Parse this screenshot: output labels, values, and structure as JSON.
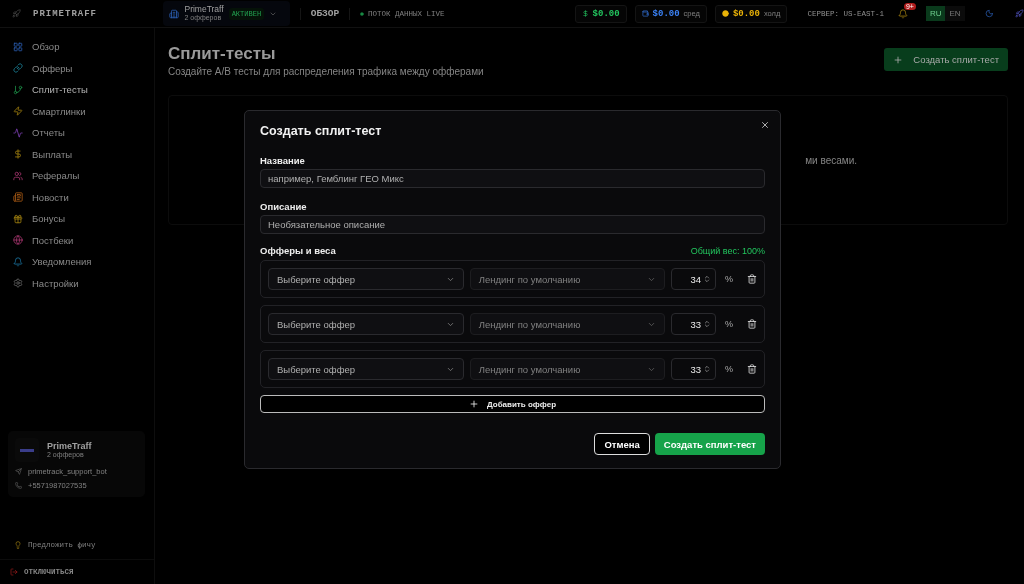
{
  "brand": {
    "name": "PRIMETRAFF"
  },
  "topbar": {
    "workspace": {
      "name": "PrimeTraff",
      "sub": "2 офферов",
      "badge": "АКТИВЕН"
    },
    "page": "ОБЗОР",
    "live": "ПОТОК ДАННЫХ LIVE",
    "balances": [
      {
        "amount": "$0.00",
        "color": "#22c55e"
      },
      {
        "amount": "$0.00",
        "label": "сред",
        "color": "#3b82f6"
      },
      {
        "amount": "$0.00",
        "label": "холд",
        "color": "#eab308"
      }
    ],
    "server": "СЕРВЕР: US-EAST-1",
    "notifications": "9+",
    "languages": [
      {
        "label": "RU",
        "selected": true
      },
      {
        "label": "EN",
        "selected": false
      }
    ]
  },
  "sidebar": {
    "items": [
      {
        "label": "Обзор",
        "selected": false
      },
      {
        "label": "Офферы",
        "selected": false
      },
      {
        "label": "Сплит-тесты",
        "selected": true
      },
      {
        "label": "Смартлинки",
        "selected": false
      },
      {
        "label": "Отчеты",
        "selected": false
      },
      {
        "label": "Выплаты",
        "selected": false
      },
      {
        "label": "Рефералы",
        "selected": false
      },
      {
        "label": "Новости",
        "selected": false
      },
      {
        "label": "Бонусы",
        "selected": false
      },
      {
        "label": "Постбеки",
        "selected": false
      },
      {
        "label": "Уведомления",
        "selected": false
      },
      {
        "label": "Настройки",
        "selected": false
      }
    ],
    "account": {
      "name": "PrimeTraff",
      "sub": "2 офферов",
      "telegram": "primetrack_support_bot",
      "phone": "+5571987027535"
    },
    "suggest": "Предложить фичу",
    "logout": "ОТКЛЮЧИТЬСЯ"
  },
  "main": {
    "title": "Сплит-тесты",
    "subtitle": "Создайте A/B тесты для распределения трафика между офферами",
    "create_button": "Создать сплит-тест",
    "empty_text": "ми весами."
  },
  "modal": {
    "title": "Создать сплит-тест",
    "name": {
      "label": "Название",
      "placeholder": "например, Гемблинг ГЕО Микс"
    },
    "description": {
      "label": "Описание",
      "placeholder": "Необязательное описание"
    },
    "offers_label": "Офферы и веса",
    "total": "Общий вес: 100%",
    "rows": [
      {
        "offer": "Выберите оффер",
        "landing": "Лендинг по умолчанию",
        "landing_disabled": true,
        "weight": "34",
        "unit": "%"
      },
      {
        "offer": "Выберите оффер",
        "landing": "Лендинг по умолчанию",
        "landing_disabled": true,
        "weight": "33",
        "unit": "%"
      },
      {
        "offer": "Выберите оффер",
        "landing": "Лендинг по умолчанию",
        "landing_disabled": true,
        "weight": "33",
        "unit": "%"
      }
    ],
    "add_button": "Добавить оффер",
    "cancel": "Отмена",
    "submit": "Создать сплит-тест"
  }
}
